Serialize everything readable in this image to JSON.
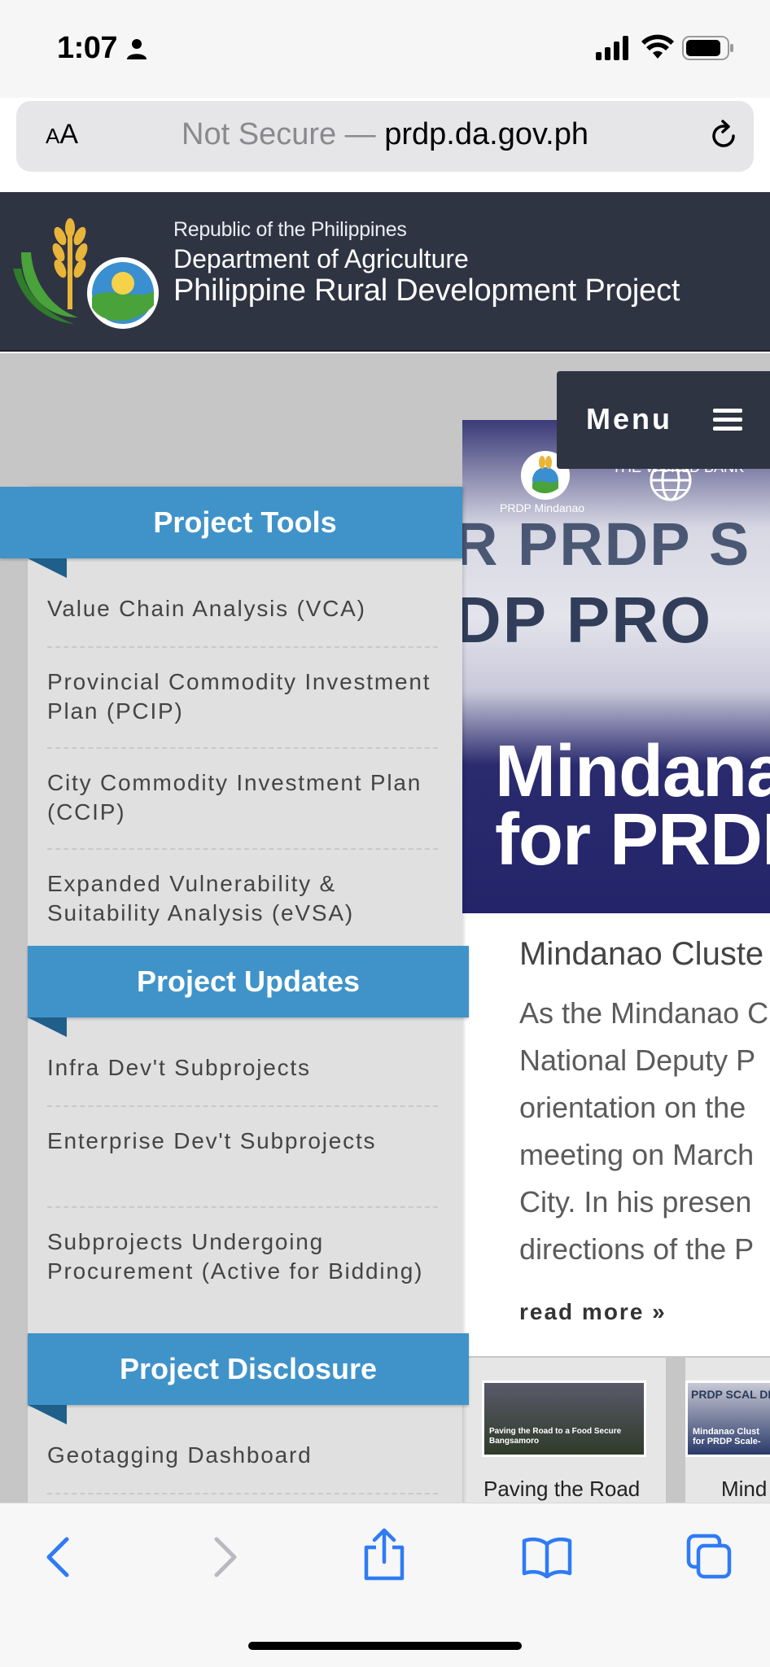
{
  "status_bar": {
    "time": "1:07"
  },
  "url_bar": {
    "aa_small": "A",
    "aa_big": "A",
    "not_secure": "Not Secure —",
    "domain": "prdp.da.gov.ph"
  },
  "header": {
    "line1": "Republic of the Philippines",
    "line2": "Department of Agriculture",
    "line3": "Philippine Rural Development Project"
  },
  "menu": {
    "label": "Menu"
  },
  "sidebar": {
    "project_tools": {
      "title": "Project Tools",
      "items": [
        "Value Chain Analysis (VCA)",
        "Provincial Commodity Investment Plan (PCIP)",
        "City Commodity Investment Plan (CCIP)",
        "Expanded Vulnerability & Suitability Analysis (eVSA)"
      ]
    },
    "project_updates": {
      "title": "Project Updates",
      "items": [
        "Infra Dev't Subprojects",
        "Enterprise Dev't Subprojects",
        "Subprojects Undergoing Procurement (Active for Bidding)"
      ]
    },
    "project_disclosure": {
      "title": "Project Disclosure",
      "items": [
        "Geotagging Dashboard"
      ]
    }
  },
  "article": {
    "banner": {
      "prdp_mindanao": "PRDP Mindanao",
      "world_bank": "THE WORLD BANK",
      "sign_line1": "R PRDP S",
      "sign_line2": "DP PRO",
      "headline_line1": "Mindanao",
      "headline_line2": "for PRDP"
    },
    "title": "Mindanao Cluste",
    "body_lines": [
      "As the Mindanao C",
      "National Deputy P",
      "orientation on the",
      "meeting on March",
      "City. In his presen",
      "directions of the P"
    ],
    "read_more": "read more »"
  },
  "related": [
    {
      "thumb_caption_line1": "Paving the Road to a Food Secure",
      "thumb_caption_line2": "Bangsamoro",
      "label": "Paving the Road"
    },
    {
      "thumb_header": "PRDP SCAL DP PROJECT",
      "thumb_caption_line1": "Mindanao Clust",
      "thumb_caption_line2": "for PRDP Scale-",
      "label": "Mind"
    }
  ],
  "colors": {
    "header_bg": "#2f3442",
    "section_blue": "#3f93c9",
    "safari_blue": "#2f7bf5"
  }
}
